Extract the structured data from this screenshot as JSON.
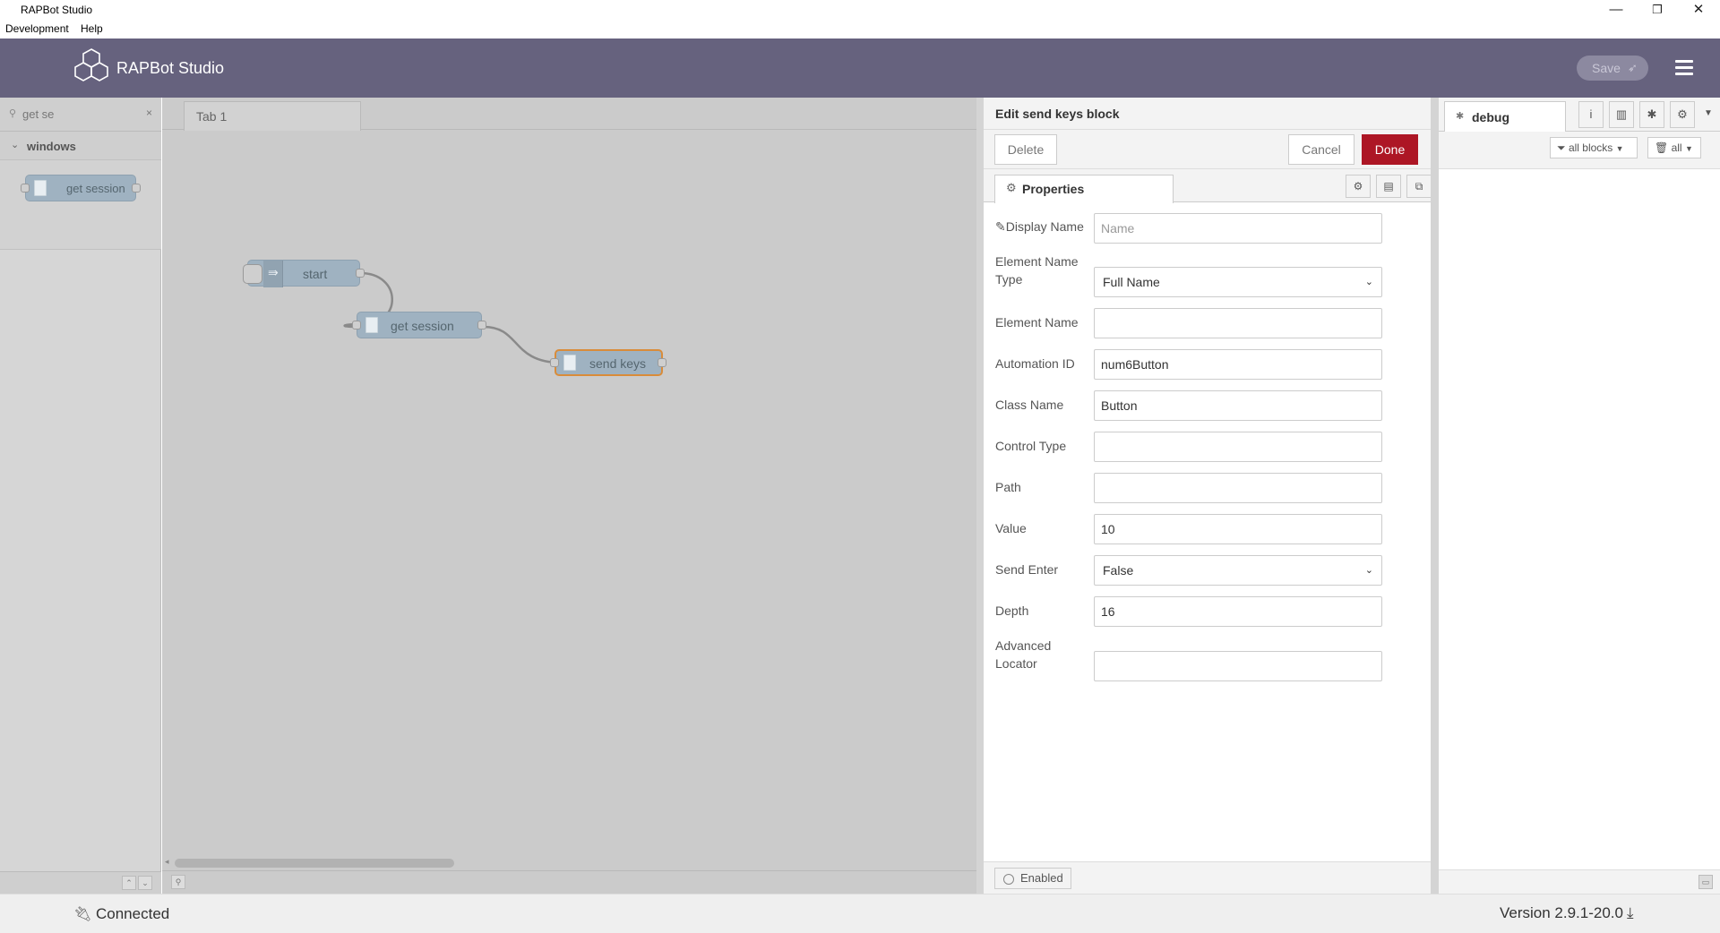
{
  "window": {
    "title": "RAPBot Studio",
    "minimize": "—",
    "restore": "❐",
    "close": "✕"
  },
  "menubar": {
    "items": [
      "Development",
      "Help"
    ]
  },
  "header": {
    "app_name": "RAPBot Studio",
    "save_label": "Save"
  },
  "palette": {
    "search_value": "get se",
    "clear": "×",
    "category": "windows",
    "nodes": [
      {
        "label": "get session"
      }
    ]
  },
  "workspace": {
    "tab": "Tab 1",
    "nodes": [
      {
        "label": "start"
      },
      {
        "label": "get session"
      },
      {
        "label": "send keys"
      }
    ]
  },
  "tray": {
    "title": "Edit send keys block",
    "delete_label": "Delete",
    "cancel_label": "Cancel",
    "done_label": "Done",
    "properties_tab": "Properties",
    "fields": {
      "display_name": {
        "label": "Display Name",
        "value": "",
        "placeholder": "Name"
      },
      "element_name_type": {
        "label": "Element Name Type",
        "value": "Full Name"
      },
      "element_name": {
        "label": "Element Name",
        "value": ""
      },
      "automation_id": {
        "label": "Automation ID",
        "value": "num6Button"
      },
      "class_name": {
        "label": "Class Name",
        "value": "Button"
      },
      "control_type": {
        "label": "Control Type",
        "value": ""
      },
      "path": {
        "label": "Path",
        "value": ""
      },
      "value": {
        "label": "Value",
        "value": "10"
      },
      "send_enter": {
        "label": "Send Enter",
        "value": "False"
      },
      "depth": {
        "label": "Depth",
        "value": "16"
      },
      "advanced_locator": {
        "label": "Advanced Locator",
        "value": ""
      }
    },
    "enabled_label": "Enabled"
  },
  "sidebar": {
    "tab": "debug",
    "filter_label": "all blocks",
    "clear_label": "all"
  },
  "status": {
    "connection": "Connected",
    "version": "Version 2.9.1-20.0"
  },
  "colors": {
    "header_bg": "#66627e",
    "done_bg": "#ad1625",
    "node_fill": "#9fb2c1",
    "selected_node_border": "#d98c3a"
  }
}
